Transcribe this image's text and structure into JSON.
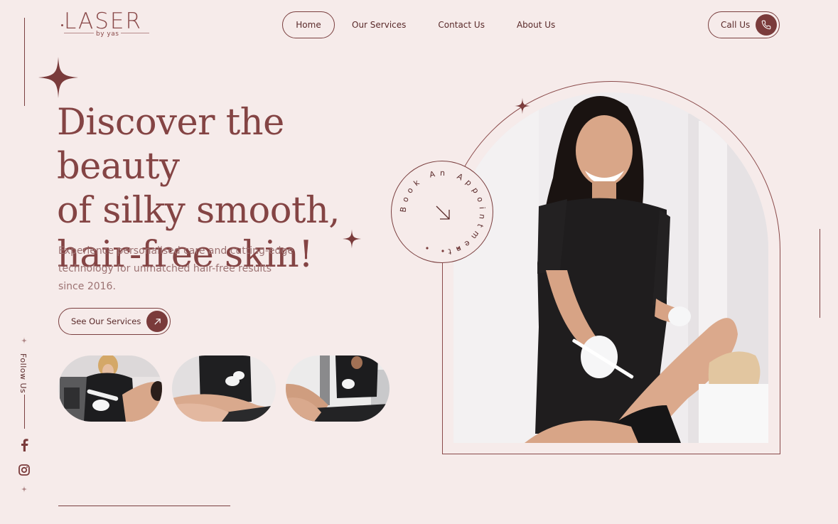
{
  "logo": {
    "main": "LASER",
    "sub": "by yas"
  },
  "nav": {
    "items": [
      "Home",
      "Our Services",
      "Contact Us",
      "About Us"
    ],
    "active": "Home"
  },
  "call": {
    "label": "Call Us",
    "icon": "phone-icon"
  },
  "hero": {
    "title_lines": [
      "Discover the beauty",
      "of silky smooth,",
      "hair-free skin!"
    ],
    "subtitle": "Experience personalised care and cutting-edge technology for unmatched hair-free results since 2016.",
    "cta_label": "See Our Services"
  },
  "badge": {
    "text": "Book An Appointment",
    "icon": "arrow-down-right-icon"
  },
  "social": {
    "label": "Follow Us",
    "icons": [
      "facebook-icon",
      "instagram-icon"
    ]
  },
  "colors": {
    "background": "#f6ebea",
    "accent": "#7a3b3b",
    "text": "#844444"
  }
}
